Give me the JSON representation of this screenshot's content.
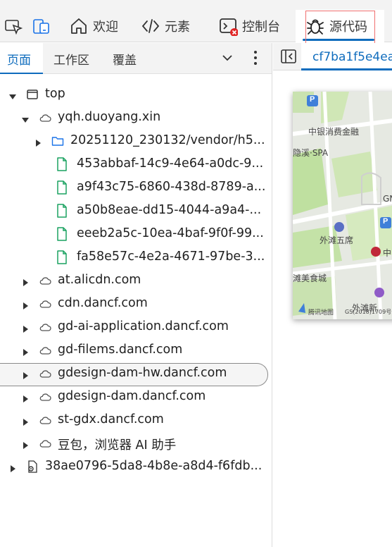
{
  "toolbar": {
    "inspect_icon": "inspect-element-icon",
    "device_icon": "device-emulation-icon",
    "tabs": [
      {
        "label": "欢迎",
        "icon": "home-icon"
      },
      {
        "label": "元素",
        "icon": "code-brackets-icon"
      },
      {
        "label": "控制台",
        "icon": "console-icon",
        "error_badge": true
      },
      {
        "label": "源代码",
        "icon": "bug-icon",
        "active": true
      }
    ]
  },
  "sources": {
    "subtabs": [
      "页面",
      "工作区",
      "覆盖"
    ],
    "active_subtab": "页面",
    "tree": [
      {
        "label": "top",
        "level": 0,
        "arrow": "expanded",
        "icon": "frame-icon"
      },
      {
        "label": "yqh.duoyang.xin",
        "level": 1,
        "arrow": "expanded",
        "icon": "cloud-icon"
      },
      {
        "label": "20251120_230132/vendor/h5...",
        "level": 2,
        "arrow": "collapsed",
        "icon": "folder-icon"
      },
      {
        "label": "453abbaf-14c9-4e64-a0dc-9...",
        "level": 3,
        "arrow": "none",
        "icon": "file-icon"
      },
      {
        "label": "a9f43c75-6860-438d-8789-a...",
        "level": 3,
        "arrow": "none",
        "icon": "file-icon"
      },
      {
        "label": "a50b8eae-dd15-4044-a9a4-...",
        "level": 3,
        "arrow": "none",
        "icon": "file-icon"
      },
      {
        "label": "eeeb2a5c-10ea-4baf-9f0f-99...",
        "level": 3,
        "arrow": "none",
        "icon": "file-icon"
      },
      {
        "label": "fa58e57c-4e2a-4671-97be-3...",
        "level": 3,
        "arrow": "none",
        "icon": "file-icon"
      },
      {
        "label": "at.alicdn.com",
        "level": 1,
        "arrow": "collapsed",
        "icon": "cloud-icon"
      },
      {
        "label": "cdn.dancf.com",
        "level": 1,
        "arrow": "collapsed",
        "icon": "cloud-icon"
      },
      {
        "label": "gd-ai-application.dancf.com",
        "level": 1,
        "arrow": "collapsed",
        "icon": "cloud-icon"
      },
      {
        "label": "gd-filems.dancf.com",
        "level": 1,
        "arrow": "collapsed",
        "icon": "cloud-icon"
      },
      {
        "label": "gdesign-dam-hw.dancf.com",
        "level": 1,
        "arrow": "collapsed",
        "icon": "cloud-icon",
        "hovered": true
      },
      {
        "label": "gdesign-dam.dancf.com",
        "level": 1,
        "arrow": "collapsed",
        "icon": "cloud-icon"
      },
      {
        "label": "st-gdx.dancf.com",
        "level": 1,
        "arrow": "collapsed",
        "icon": "cloud-icon"
      },
      {
        "label": "豆包，浏览器 AI 助手",
        "level": 1,
        "arrow": "collapsed",
        "icon": "cloud-icon"
      },
      {
        "label": "38ae0796-5da8-4b8e-a8d4-f6fdb...",
        "level": 0,
        "arrow": "collapsed",
        "icon": "gear-file-icon"
      }
    ]
  },
  "editor": {
    "file_tab": "cf7ba1f5e4ea",
    "map_labels": [
      "中银消费金融",
      "隐溪·SPA",
      "GN",
      "外滩五席",
      "中",
      "滩美食城",
      "外滩新",
      "腾讯地图",
      "GS(2018)1709号"
    ]
  },
  "colors": {
    "accent": "#0f6cbd",
    "file_icon": "#1aa260",
    "folder_icon": "#1a73e8",
    "error_badge": "#e02424"
  }
}
